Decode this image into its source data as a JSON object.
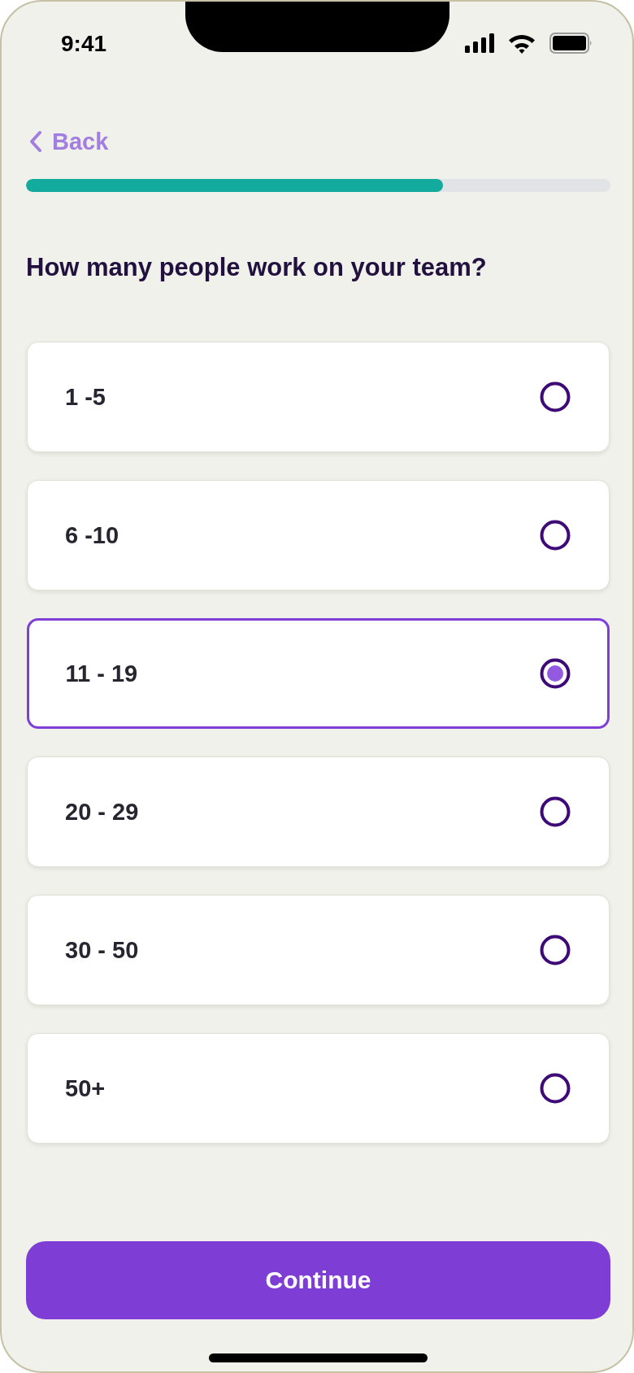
{
  "status_bar": {
    "time": "9:41"
  },
  "back": {
    "label": "Back"
  },
  "progress": {
    "level": 0.713
  },
  "question": "How many people work on your team?",
  "options": [
    {
      "label": "1 -5",
      "selected": false
    },
    {
      "label": "6 -10",
      "selected": false
    },
    {
      "label": "11 - 19",
      "selected": true
    },
    {
      "label": "20 - 29",
      "selected": false
    },
    {
      "label": "30 - 50",
      "selected": false
    },
    {
      "label": "50+",
      "selected": false
    }
  ],
  "continue_button": {
    "label": "Continue"
  }
}
